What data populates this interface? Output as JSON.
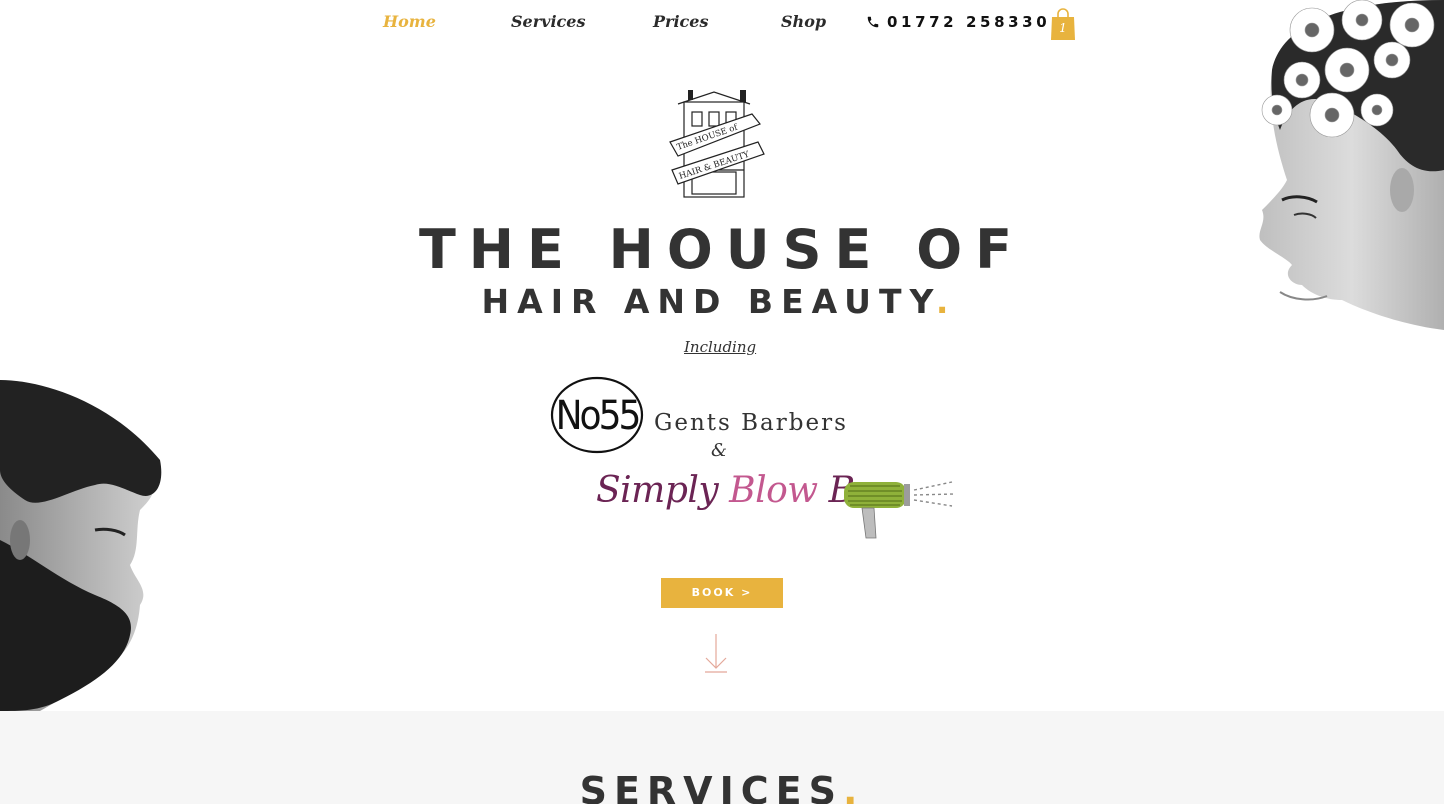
{
  "nav": {
    "items": [
      {
        "label": "Home",
        "active": true
      },
      {
        "label": "Services",
        "active": false
      },
      {
        "label": "Prices",
        "active": false
      },
      {
        "label": "Shop",
        "active": false
      }
    ],
    "phone": "01772 258330",
    "cart_count": "1"
  },
  "logo": {
    "banner_line1": "The HOUSE of",
    "banner_line2": "HAIR & BEAUTY"
  },
  "hero": {
    "title": "THE HOUSE OF",
    "subtitle": "HAIR AND BEAUTY",
    "subtitle_dot": ".",
    "including": "Including",
    "no55_mark": "No55",
    "gents": "Gents Barbers",
    "ampersand": "&",
    "blow_bar_part1": "Simply ",
    "blow_bar_part2": "Blow ",
    "blow_bar_part3": "Bar",
    "book_label": "BOOK >"
  },
  "services": {
    "title": "SERVICES",
    "dot": "."
  },
  "colors": {
    "accent": "#e8b33e",
    "text": "#333333",
    "band": "#f6f6f6",
    "blowbar_dark": "#6b2454",
    "blowbar_pink": "#c3588f"
  }
}
